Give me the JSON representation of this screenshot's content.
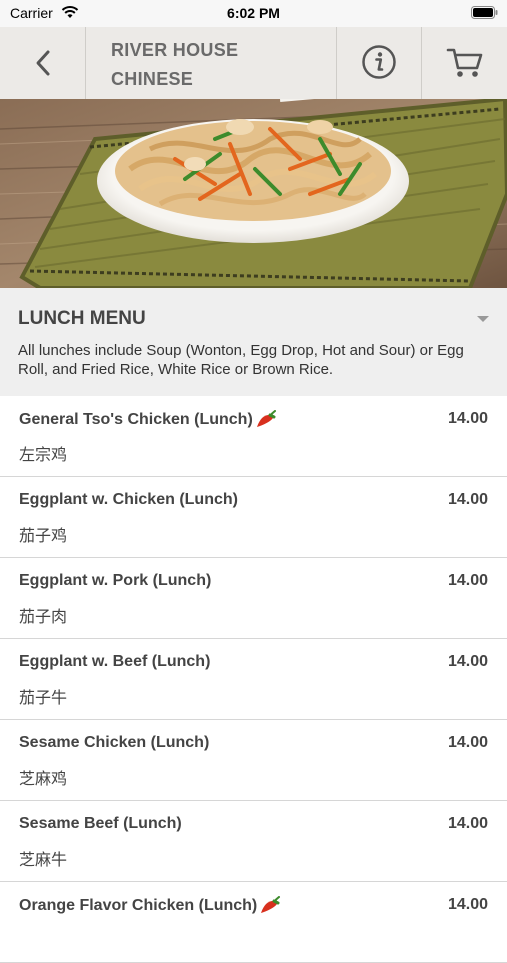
{
  "status_bar": {
    "carrier": "Carrier",
    "time": "6:02 PM"
  },
  "nav": {
    "title_line1": "RIVER HOUSE",
    "title_line2": "CHINESE",
    "back_icon": "chevron-left-icon",
    "info_icon": "info-icon",
    "cart_icon": "cart-icon"
  },
  "section": {
    "title": "LUNCH MENU",
    "description": "All lunches include Soup (Wonton, Egg Drop, Hot and Sour) or Egg Roll, and Fried Rice, White Rice or Brown Rice."
  },
  "items": [
    {
      "name": "General Tso's Chicken (Lunch)",
      "chinese": "左宗鸡",
      "price": "14.00",
      "spicy": true
    },
    {
      "name": "Eggplant w. Chicken (Lunch)",
      "chinese": "茄子鸡",
      "price": "14.00",
      "spicy": false
    },
    {
      "name": "Eggplant w. Pork (Lunch)",
      "chinese": "茄子肉",
      "price": "14.00",
      "spicy": false
    },
    {
      "name": "Eggplant w. Beef (Lunch)",
      "chinese": "茄子牛",
      "price": "14.00",
      "spicy": false
    },
    {
      "name": "Sesame Chicken (Lunch)",
      "chinese": "芝麻鸡",
      "price": "14.00",
      "spicy": false
    },
    {
      "name": "Sesame Beef (Lunch)",
      "chinese": "芝麻牛",
      "price": "14.00",
      "spicy": false
    },
    {
      "name": "Orange Flavor Chicken (Lunch)",
      "chinese": "",
      "price": "14.00",
      "spicy": true
    }
  ],
  "colors": {
    "nav_bg": "#ebe9e6",
    "section_bg": "#efefef",
    "text": "#444444",
    "chili": "#d8301e"
  }
}
